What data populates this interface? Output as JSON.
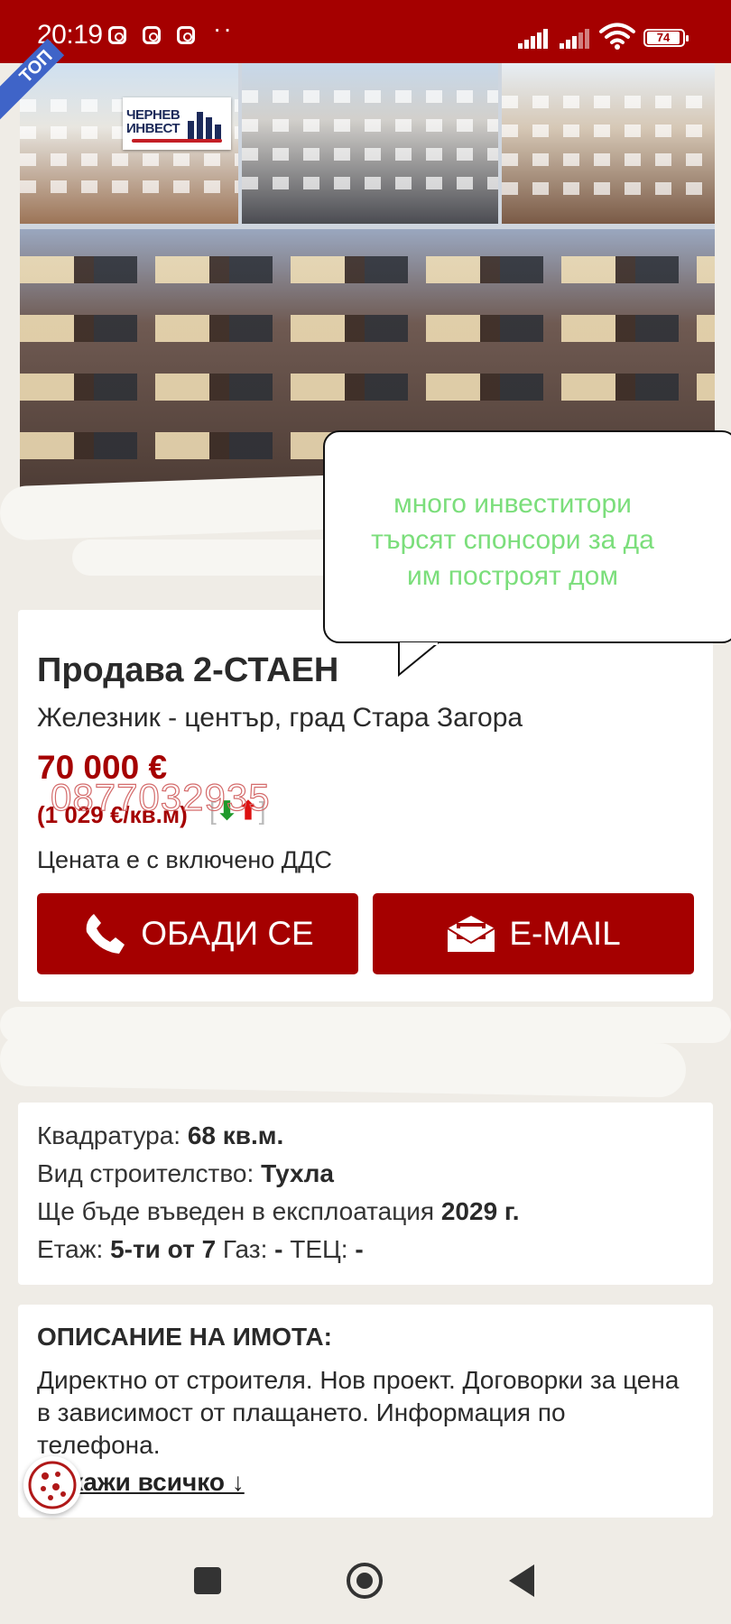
{
  "status_bar": {
    "time": "20:19",
    "battery": "74"
  },
  "listing": {
    "ribbon": "ТОП",
    "brand_logo_text_line1": "ЧЕРНЕВ",
    "brand_logo_text_line2": "ИНВЕСТ",
    "title": "Продава 2-СТАЕН",
    "location": "Железник - център, град Стара Загора",
    "price": "70 000 €",
    "price_per_sqm": "(1 029 €/кв.м)",
    "phone_watermark": "0877032935",
    "vat_note": "Цената е с включено ДДС",
    "call_label": "ОБАДИ СЕ",
    "email_label": "E-MAIL"
  },
  "bubble": {
    "text": "много инвеститори търсят спонсори за да им построят дом"
  },
  "details": {
    "area_label": "Квадратура:",
    "area_value": "68 кв.м.",
    "construction_label": "Вид строителство:",
    "construction_value": "Тухла",
    "commission_label": "Ще бъде въведен в експлоатация",
    "commission_value": "2029 г.",
    "floor_label": "Етаж:",
    "floor_value": "5-ти от 7",
    "gas_label": "Газ:",
    "gas_value": "-",
    "tec_label": "ТЕЦ:",
    "tec_value": "-"
  },
  "description": {
    "heading": "ОПИСАНИЕ НА ИМОТА:",
    "text": "Директно от строителя. Нов проект. Договорки за цена в зависимост от плащането. Информация по телефона.",
    "show_all": "Покажи всичко ↓"
  },
  "colors": {
    "accent": "#a50000",
    "bubble_text": "#7bde7b",
    "background": "#efece6"
  },
  "icons": [
    "instagram-icon",
    "signal-icon",
    "wifi-icon",
    "battery-icon",
    "phone-icon",
    "envelope-icon",
    "cookie-icon",
    "recents-icon",
    "home-icon",
    "back-icon"
  ]
}
